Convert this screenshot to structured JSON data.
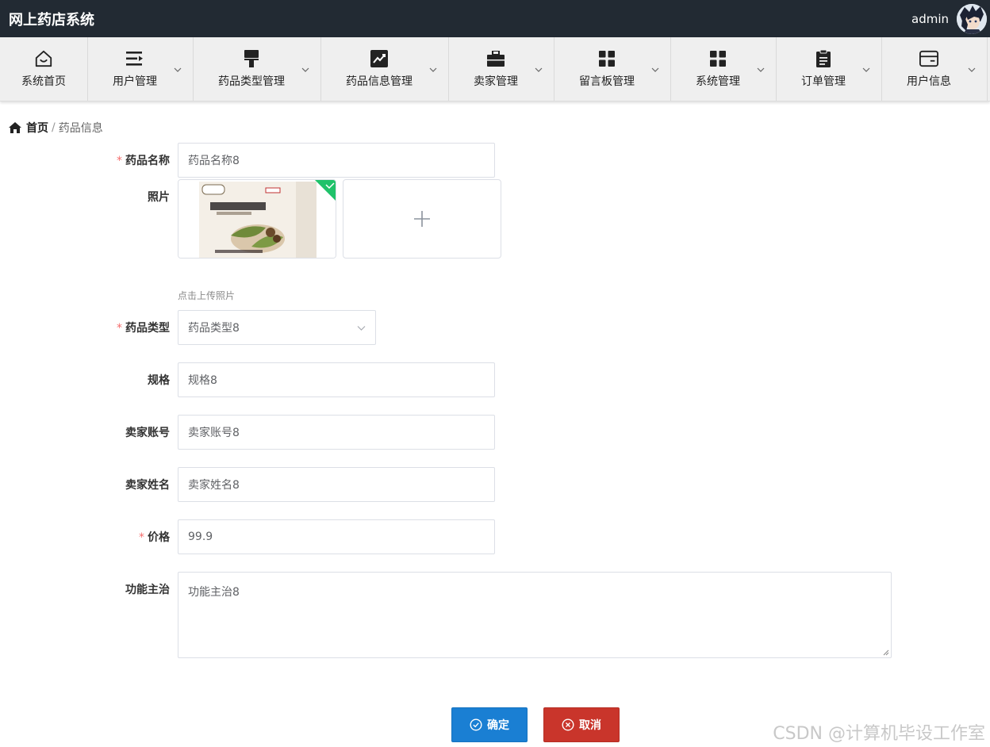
{
  "app": {
    "title": "网上药店系统",
    "user": "admin"
  },
  "nav": [
    {
      "label": "系统首页",
      "icon": "home-icon",
      "dropdown": false
    },
    {
      "label": "用户管理",
      "icon": "list-icon",
      "dropdown": true
    },
    {
      "label": "药品类型管理",
      "icon": "paint-roller-icon",
      "dropdown": true
    },
    {
      "label": "药品信息管理",
      "icon": "chart-line-icon",
      "dropdown": true
    },
    {
      "label": "卖家管理",
      "icon": "briefcase-icon",
      "dropdown": true
    },
    {
      "label": "留言板管理",
      "icon": "grid-icon",
      "dropdown": true
    },
    {
      "label": "系统管理",
      "icon": "grid-icon",
      "dropdown": true
    },
    {
      "label": "订单管理",
      "icon": "clipboard-icon",
      "dropdown": true
    },
    {
      "label": "用户信息",
      "icon": "card-icon",
      "dropdown": true
    }
  ],
  "breadcrumb": {
    "home": "首页",
    "separator": "/",
    "current": "药品信息"
  },
  "form": {
    "name": {
      "label": "药品名称",
      "value": "药品名称8",
      "required": true
    },
    "photo": {
      "label": "照片",
      "tip": "点击上传照片"
    },
    "type": {
      "label": "药品类型",
      "value": "药品类型8",
      "required": true
    },
    "spec": {
      "label": "规格",
      "value": "规格8"
    },
    "seller_account": {
      "label": "卖家账号",
      "value": "卖家账号8"
    },
    "seller_name": {
      "label": "卖家姓名",
      "value": "卖家姓名8"
    },
    "price": {
      "label": "价格",
      "value": "99.9",
      "required": true
    },
    "function": {
      "label": "功能主治",
      "value": "功能主治8"
    }
  },
  "buttons": {
    "confirm": "确定",
    "cancel": "取消"
  },
  "watermark": "CSDN @计算机毕设工作室",
  "colors": {
    "topbar": "#222a33",
    "primary": "#1a7fd3",
    "danger": "#c9352b",
    "required": "#f56c6c"
  }
}
